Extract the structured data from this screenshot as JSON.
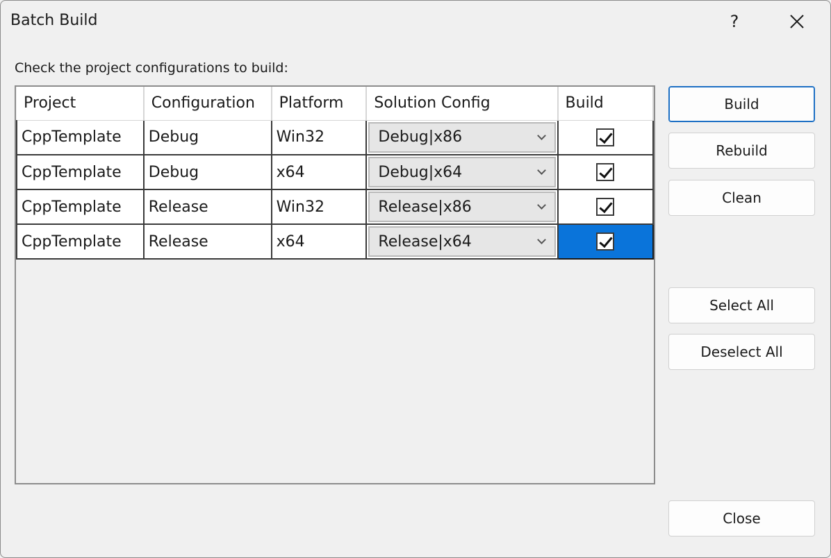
{
  "window": {
    "title": "Batch Build",
    "help_label": "?",
    "close_glyph": "✕"
  },
  "instruction": "Check the project configurations to build:",
  "grid": {
    "columns": [
      "Project",
      "Configuration",
      "Platform",
      "Solution Config",
      "Build"
    ],
    "rows": [
      {
        "project": "CppTemplate",
        "configuration": "Debug",
        "platform": "Win32",
        "solution_config": "Debug|x86",
        "build": true
      },
      {
        "project": "CppTemplate",
        "configuration": "Debug",
        "platform": "x64",
        "solution_config": "Debug|x64",
        "build": true
      },
      {
        "project": "CppTemplate",
        "configuration": "Release",
        "platform": "Win32",
        "solution_config": "Release|x86",
        "build": true
      },
      {
        "project": "CppTemplate",
        "configuration": "Release",
        "platform": "x64",
        "solution_config": "Release|x64",
        "build": true
      }
    ],
    "selected_row": 3,
    "selected_color": "#0a74da"
  },
  "buttons": {
    "build": "Build",
    "rebuild": "Rebuild",
    "clean": "Clean",
    "select_all": "Select All",
    "deselect_all": "Deselect All",
    "close": "Close"
  },
  "icons": {
    "help": "help-icon",
    "close": "close-icon",
    "dropdown": "chevron-down-icon",
    "checkbox": "checkbox-checked-icon"
  },
  "colors": {
    "accent": "#1c6fc4",
    "background": "#f0f0f0"
  }
}
